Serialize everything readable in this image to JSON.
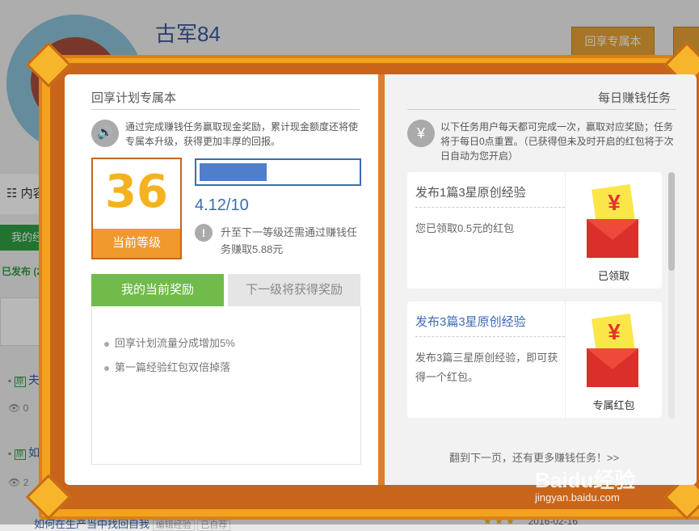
{
  "background": {
    "user_name": "古军84",
    "top_button": "回享专属本",
    "side_nav_label": "内容",
    "side_green_tab": "我的经",
    "side_published": "已发布 (2",
    "row1_title": "夫",
    "row1_views": "0",
    "row2_title": "如",
    "row2_views": "2",
    "bottom_link": "如何在生产当中找回自我",
    "bottom_tag1": "编辑经验",
    "bottom_tag2": "已自荐",
    "bottom_date": "2016-02-16"
  },
  "left_page": {
    "title": "回享计划专属本",
    "description": "通过完成赚钱任务赢取现金奖励，累计现金额度还将使专属本升级，获得更加丰厚的回报。",
    "level": {
      "number": "36",
      "label": "当前等级"
    },
    "progress": {
      "value_text": "4.12/10",
      "fraction": 0.43
    },
    "next_level_text": "升至下一等级还需通过赚钱任务赚取5.88元",
    "tabs": {
      "current": "我的当前奖励",
      "next": "下一级将获得奖励"
    },
    "rewards": [
      "回享计划流量分成增加5%",
      "第一篇经验红包双倍掉落"
    ]
  },
  "right_page": {
    "title": "每日赚钱任务",
    "description": "以下任务用户每天都可完成一次，赢取对应奖励；任务将于每日0点重置。（已获得但未及时开启的红包将于次日自动为您开启）",
    "tasks": [
      {
        "title": "发布1篇3星原创经验",
        "desc": "您已领取0.5元的红包",
        "status": "已领取",
        "title_color": "#555555"
      },
      {
        "title": "发布3篇3星原创经验",
        "desc": "发布3篇三星原创经验，即可获得一个红包。",
        "status": "专属红包",
        "title_color": "#3e6bb3"
      }
    ],
    "next_page_text": "翻到下一页，还有更多赚钱任务！>>"
  },
  "watermark": {
    "brand": "Baidu经验",
    "url": "jingyan.baidu.com"
  },
  "colors": {
    "frame_orange": "#f3a21d",
    "level_yellow": "#f4b31e",
    "tab_green": "#70bb4a",
    "progress_blue": "#3e6bb3"
  },
  "icons": {
    "speaker": "speaker-icon",
    "yen": "yen-circle-icon",
    "info": "exclamation-icon"
  }
}
